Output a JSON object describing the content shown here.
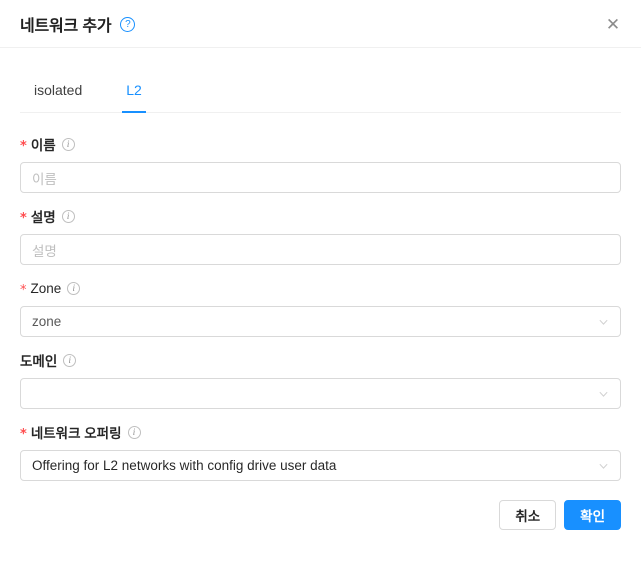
{
  "header": {
    "title": "네트워크 추가",
    "help_icon": "question-circle-icon",
    "help_glyph": "?",
    "close_icon": "close-icon",
    "close_glyph": "✕"
  },
  "tabs": [
    {
      "label": "isolated",
      "active": false
    },
    {
      "label": "L2",
      "active": true
    }
  ],
  "fields": [
    {
      "label": "이름",
      "required": true,
      "info_icon": "info-circle-icon",
      "type": "input",
      "value": "",
      "placeholder": "이름"
    },
    {
      "label": "설명",
      "required": true,
      "info_icon": "info-circle-icon",
      "type": "input",
      "value": "",
      "placeholder": "설명"
    },
    {
      "label": "Zone",
      "required": true,
      "info_icon": "info-circle-icon",
      "type": "select",
      "value": "zone",
      "placeholder": "zone"
    },
    {
      "label": "도메인",
      "required": false,
      "info_icon": "info-circle-icon",
      "type": "select",
      "value": "",
      "placeholder": ""
    },
    {
      "label": "네트워크 오퍼링",
      "required": true,
      "info_icon": "info-circle-icon",
      "type": "select",
      "value": "Offering for L2 networks with config drive user data",
      "placeholder": ""
    }
  ],
  "footer": {
    "cancel_label": "취소",
    "confirm_label": "확인"
  },
  "colors": {
    "accent": "#1890ff",
    "required": "#ff4d4f",
    "border": "#d9d9d9",
    "divider": "#f0f0f0",
    "placeholder": "#bfbfbf"
  }
}
